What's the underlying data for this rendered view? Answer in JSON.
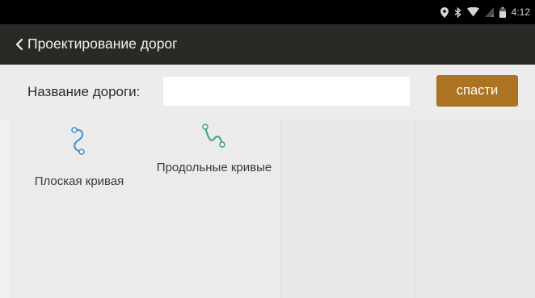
{
  "status_bar": {
    "time": "4:12",
    "icons": [
      "location-icon",
      "bluetooth-icon",
      "wifi-icon",
      "signal-icon",
      "battery-icon"
    ]
  },
  "app_bar": {
    "title": "Проектирование дорог",
    "back_icon": "chevron-left-icon"
  },
  "form": {
    "road_name_label": "Название дороги:",
    "road_name_value": "",
    "save_label": "спасти"
  },
  "tools": [
    {
      "label": "Плоская кривая",
      "icon": "flat-curve-icon"
    },
    {
      "label": "Продольные кривые",
      "icon": "longitudinal-curve-icon"
    }
  ],
  "colors": {
    "status_bar_bg": "#000000",
    "app_bar_bg": "#2b2926",
    "save_button_bg": "#ac7421",
    "flat_curve_icon": "#3f8fd0",
    "longitudinal_curve_icon": "#3aa389"
  }
}
